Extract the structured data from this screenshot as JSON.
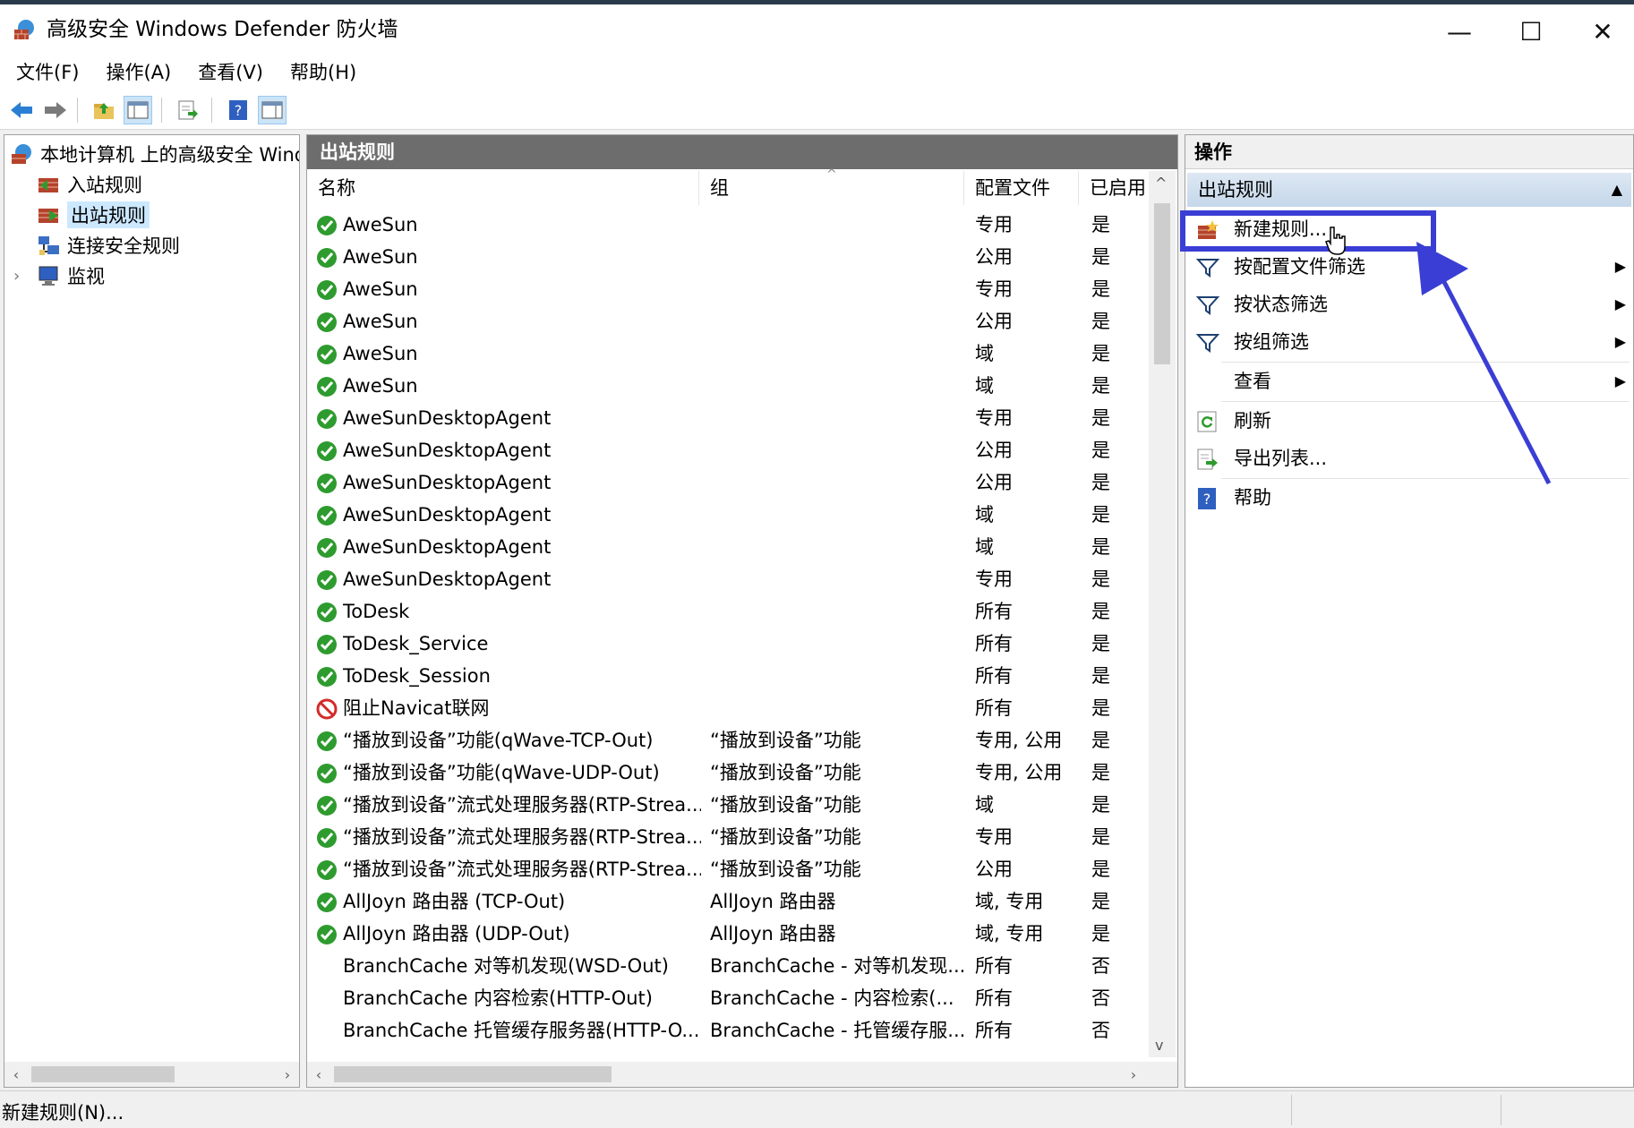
{
  "window": {
    "title": "高级安全 Windows Defender 防火墙",
    "minimize_glyph": "—",
    "maximize_glyph": "☐",
    "close_glyph": "✕"
  },
  "menu": [
    "文件(F)",
    "操作(A)",
    "查看(V)",
    "帮助(H)"
  ],
  "tree": {
    "root": "本地计算机 上的高级安全 Windows Defender 防火墙",
    "items": [
      "入站规则",
      "出站规则",
      "连接安全规则",
      "监视"
    ],
    "selected": "出站规则"
  },
  "center": {
    "header": "出站规则",
    "columns": [
      "名称",
      "组",
      "配置文件",
      "已启用"
    ],
    "rows": [
      {
        "status": "enabled",
        "name": "AweSun",
        "group": "",
        "profile": "专用",
        "enabled": "是"
      },
      {
        "status": "enabled",
        "name": "AweSun",
        "group": "",
        "profile": "公用",
        "enabled": "是"
      },
      {
        "status": "enabled",
        "name": "AweSun",
        "group": "",
        "profile": "专用",
        "enabled": "是"
      },
      {
        "status": "enabled",
        "name": "AweSun",
        "group": "",
        "profile": "公用",
        "enabled": "是"
      },
      {
        "status": "enabled",
        "name": "AweSun",
        "group": "",
        "profile": "域",
        "enabled": "是"
      },
      {
        "status": "enabled",
        "name": "AweSun",
        "group": "",
        "profile": "域",
        "enabled": "是"
      },
      {
        "status": "enabled",
        "name": "AweSunDesktopAgent",
        "group": "",
        "profile": "专用",
        "enabled": "是"
      },
      {
        "status": "enabled",
        "name": "AweSunDesktopAgent",
        "group": "",
        "profile": "公用",
        "enabled": "是"
      },
      {
        "status": "enabled",
        "name": "AweSunDesktopAgent",
        "group": "",
        "profile": "公用",
        "enabled": "是"
      },
      {
        "status": "enabled",
        "name": "AweSunDesktopAgent",
        "group": "",
        "profile": "域",
        "enabled": "是"
      },
      {
        "status": "enabled",
        "name": "AweSunDesktopAgent",
        "group": "",
        "profile": "域",
        "enabled": "是"
      },
      {
        "status": "enabled",
        "name": "AweSunDesktopAgent",
        "group": "",
        "profile": "专用",
        "enabled": "是"
      },
      {
        "status": "enabled",
        "name": "ToDesk",
        "group": "",
        "profile": "所有",
        "enabled": "是"
      },
      {
        "status": "enabled",
        "name": "ToDesk_Service",
        "group": "",
        "profile": "所有",
        "enabled": "是"
      },
      {
        "status": "enabled",
        "name": "ToDesk_Session",
        "group": "",
        "profile": "所有",
        "enabled": "是"
      },
      {
        "status": "blocked",
        "name": "阻止Navicat联网",
        "group": "",
        "profile": "所有",
        "enabled": "是"
      },
      {
        "status": "enabled",
        "name": "“播放到设备”功能(qWave-TCP-Out)",
        "group": "“播放到设备”功能",
        "profile": "专用, 公用",
        "enabled": "是"
      },
      {
        "status": "enabled",
        "name": "“播放到设备”功能(qWave-UDP-Out)",
        "group": "“播放到设备”功能",
        "profile": "专用, 公用",
        "enabled": "是"
      },
      {
        "status": "enabled",
        "name": "“播放到设备”流式处理服务器(RTP-Strea...",
        "group": "“播放到设备”功能",
        "profile": "域",
        "enabled": "是"
      },
      {
        "status": "enabled",
        "name": "“播放到设备”流式处理服务器(RTP-Strea...",
        "group": "“播放到设备”功能",
        "profile": "专用",
        "enabled": "是"
      },
      {
        "status": "enabled",
        "name": "“播放到设备”流式处理服务器(RTP-Strea...",
        "group": "“播放到设备”功能",
        "profile": "公用",
        "enabled": "是"
      },
      {
        "status": "enabled",
        "name": "AllJoyn 路由器 (TCP-Out)",
        "group": "AllJoyn 路由器",
        "profile": "域, 专用",
        "enabled": "是"
      },
      {
        "status": "enabled",
        "name": "AllJoyn 路由器 (UDP-Out)",
        "group": "AllJoyn 路由器",
        "profile": "域, 专用",
        "enabled": "是"
      },
      {
        "status": "none",
        "name": "BranchCache 对等机发现(WSD-Out)",
        "group": "BranchCache - 对等机发现...",
        "profile": "所有",
        "enabled": "否"
      },
      {
        "status": "none",
        "name": "BranchCache 内容检索(HTTP-Out)",
        "group": "BranchCache - 内容检索(...",
        "profile": "所有",
        "enabled": "否"
      },
      {
        "status": "none",
        "name": "BranchCache 托管缓存服务器(HTTP-O...",
        "group": "BranchCache - 托管缓存服...",
        "profile": "所有",
        "enabled": "否"
      }
    ]
  },
  "actions": {
    "header": "操作",
    "section": "出站规则",
    "items": [
      {
        "label": "新建规则...",
        "icon": "new-rule-icon",
        "submenu": false
      },
      {
        "label": "按配置文件筛选",
        "icon": "filter-icon",
        "submenu": true
      },
      {
        "label": "按状态筛选",
        "icon": "filter-icon",
        "submenu": true
      },
      {
        "label": "按组筛选",
        "icon": "filter-icon",
        "submenu": true
      },
      {
        "label": "查看",
        "icon": "",
        "submenu": true
      },
      {
        "label": "刷新",
        "icon": "refresh-icon",
        "submenu": false
      },
      {
        "label": "导出列表...",
        "icon": "export-icon",
        "submenu": false
      },
      {
        "label": "帮助",
        "icon": "help-icon",
        "submenu": false
      }
    ]
  },
  "status": {
    "text": "新建规则(N)..."
  },
  "colors": {
    "pane_header": "#6d6d6d",
    "selection": "#cce8ff",
    "annotation": "#3a3ed4",
    "enabled_green": "#2e9b2e",
    "blocked_red": "#d42a2a"
  }
}
